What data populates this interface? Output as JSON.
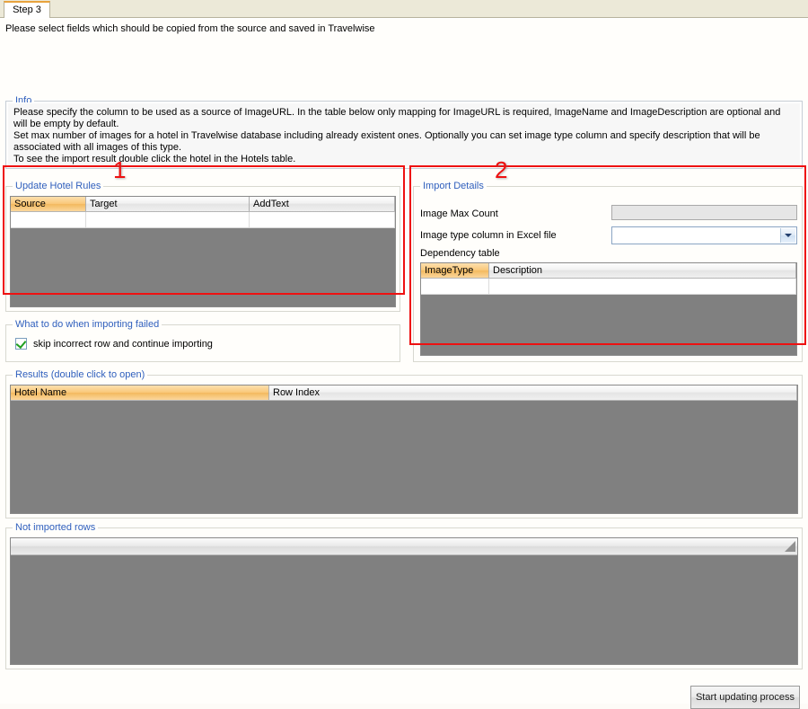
{
  "window": {
    "tab_label": "Step 3",
    "intro_text": "Please select fields which should be copied from the source and saved in Travelwise"
  },
  "info": {
    "legend": "Info",
    "lines": [
      "Please specify the column to be used as a source of ImageURL. In the table below only mapping for ImageURL is required, ImageName and ImageDescription are optional and will be empty by default.",
      "Set max number of images for a hotel in Travelwise database including already existent ones. Optionally you can set image type column and specify description that will be associated with all images of this type.",
      "To see the import result double click the hotel in the Hotels table."
    ]
  },
  "update_hotel_rules": {
    "legend": "Update Hotel Rules",
    "annotation": "1",
    "columns": [
      "Source",
      "Target",
      "AddText"
    ],
    "selected_column": "Source",
    "rows": []
  },
  "import_details": {
    "legend": "Import Details",
    "annotation": "2",
    "image_max_count_label": "Image Max Count",
    "image_max_count_value": "",
    "image_type_column_label": "Image type column in Excel file",
    "image_type_column_value": "",
    "dependency_table_label": "Dependency table",
    "dependency_columns": [
      "ImageType",
      "Description"
    ],
    "dependency_selected_column": "ImageType",
    "dependency_rows": []
  },
  "import_failed": {
    "legend": "What to do when importing failed",
    "checkbox_label": "skip incorrect row and continue importing",
    "checkbox_checked": true
  },
  "results": {
    "legend": "Results (double click to open)",
    "columns": [
      "Hotel Name",
      "Row Index"
    ],
    "selected_column": "Hotel Name",
    "rows": []
  },
  "not_imported": {
    "legend": "Not imported rows",
    "rows": []
  },
  "footer": {
    "start_button_label": "Start updating process"
  },
  "colors": {
    "accent_orange": "#f3b95f",
    "legend_blue": "#2f5fbd",
    "annotation_red": "#ee1111",
    "empty_grid_gray": "#808080"
  }
}
